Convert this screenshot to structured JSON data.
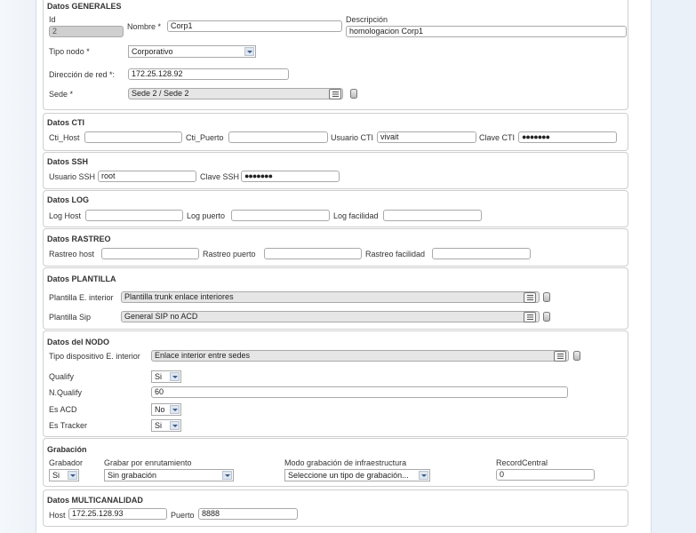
{
  "generales": {
    "legend": "Datos GENERALES",
    "id_label": "Id",
    "id_value": "2",
    "nombre_label": "Nombre *",
    "nombre_value": "Corp1",
    "descripcion_label": "Descripción",
    "descripcion_value": "homologacion Corp1",
    "tipo_nodo_label": "Tipo nodo *",
    "tipo_nodo_value": "Corporativo",
    "direccion_label": "Dirección de red *:",
    "direccion_value": "172.25.128.92",
    "sede_label": "Sede *",
    "sede_value": "Sede 2 / Sede 2"
  },
  "cti": {
    "legend": "Datos CTI",
    "host_label": "Cti_Host",
    "host_value": "",
    "puerto_label": "Cti_Puerto",
    "puerto_value": "",
    "usuario_label": "Usuario CTI",
    "usuario_value": "vivait",
    "clave_label": "Clave CTI",
    "clave_value": "●●●●●●●"
  },
  "ssh": {
    "legend": "Datos SSH",
    "usuario_label": "Usuario SSH",
    "usuario_value": "root",
    "clave_label": "Clave SSH",
    "clave_value": "●●●●●●●"
  },
  "log": {
    "legend": "Datos LOG",
    "host_label": "Log Host",
    "puerto_label": "Log puerto",
    "facilidad_label": "Log facilidad"
  },
  "rastreo": {
    "legend": "Datos RASTREO",
    "host_label": "Rastreo host",
    "puerto_label": "Rastreo puerto",
    "facilidad_label": "Rastreo facilidad"
  },
  "plantilla": {
    "legend": "Datos PLANTILLA",
    "interior_label": "Plantilla E. interior",
    "interior_value": "Plantilla trunk enlace interiores",
    "sip_label": "Plantilla Sip",
    "sip_value": "General SIP no ACD"
  },
  "nodo": {
    "legend": "Datos del NODO",
    "tipo_label": "Tipo dispositivo E. interior",
    "tipo_value": "Enlace interior entre sedes",
    "qualify_label": "Qualify",
    "qualify_value": "Si",
    "nqualify_label": "N.Qualify",
    "nqualify_value": "60",
    "acd_label": "Es ACD",
    "acd_value": "No",
    "tracker_label": "Es Tracker",
    "tracker_value": "Si"
  },
  "grabacion": {
    "legend": "Grabación",
    "grabador_label": "Grabador",
    "grabador_value": "Si",
    "enrutamiento_label": "Grabar por enrutamiento",
    "enrutamiento_value": "Sin grabación",
    "modo_label": "Modo grabación de infraestructura",
    "modo_value": "Seleccione un tipo de grabación...",
    "record_label": "RecordCentral",
    "record_value": "0"
  },
  "multicanal": {
    "legend": "Datos MULTICANALIDAD",
    "host_label": "Host",
    "host_value": "172.25.128.93",
    "puerto_label": "Puerto",
    "puerto_value": "8888"
  }
}
